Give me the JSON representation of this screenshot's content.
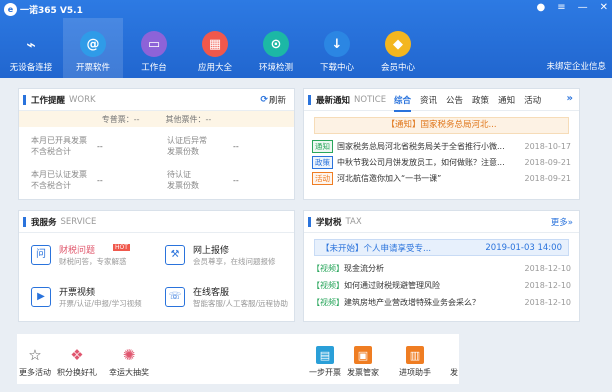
{
  "app": {
    "title": "一诺365 V5.1",
    "logo_glyph": "e",
    "unbound_label": "未绑定企业信息"
  },
  "window_controls": {
    "skin": "●",
    "menu": "≡",
    "minimize": "—",
    "close": "✕"
  },
  "nav": [
    {
      "label": "无设备连接",
      "icon": "usb-icon",
      "glyph": "⌁",
      "color": "#2166cf"
    },
    {
      "label": "开票软件",
      "icon": "paper-icon",
      "glyph": "@",
      "color": "#2f9be8"
    },
    {
      "label": "工作台",
      "icon": "monitor-icon",
      "glyph": "▭",
      "color": "#8d63d8"
    },
    {
      "label": "应用大全",
      "icon": "apps-icon",
      "glyph": "▦",
      "color": "#f0584c"
    },
    {
      "label": "环境检测",
      "icon": "check-icon",
      "glyph": "⊙",
      "color": "#1cb8a5"
    },
    {
      "label": "下载中心",
      "icon": "download-icon",
      "glyph": "↓",
      "color": "#2b86e3"
    },
    {
      "label": "会员中心",
      "icon": "diamond-icon",
      "glyph": "◆",
      "color": "#f3b61f"
    }
  ],
  "work": {
    "title": "工作提醒",
    "en": "WORK",
    "refresh": "刷新",
    "summary": {
      "zhuanpiao": "专普票：--",
      "qita": "其他票件：--"
    },
    "items": [
      {
        "label1": "本月已开具发票",
        "label2": "不含税合计",
        "value": "--"
      },
      {
        "label1": "认证后异常",
        "label2": "发票份数",
        "value": "--"
      },
      {
        "label1": "本月已认证发票",
        "label2": "不含税合计",
        "value": "--"
      },
      {
        "label1": "待认证",
        "label2": "发票份数",
        "value": "--"
      }
    ]
  },
  "notice": {
    "title": "最新通知",
    "en": "NOTICE",
    "tabs": [
      "综合",
      "资讯",
      "公告",
      "政策",
      "通知",
      "活动"
    ],
    "banner": "【通知】国家税务总局河北...",
    "items": [
      {
        "tag": "通知",
        "tag_color": "#2aa65c",
        "text": "国家税务总局河北省税务局关于全省推行小微...",
        "date": "2018-10-17"
      },
      {
        "tag": "政策",
        "tag_color": "#2a73dc",
        "text": "中秋节我公司月饼发放员工，如何做账？注意...",
        "date": "2018-09-21"
      },
      {
        "tag": "活动",
        "tag_color": "#ef7d22",
        "text": "河北航信邀你加入“一书一课”",
        "date": "2018-09-21"
      }
    ]
  },
  "service": {
    "title": "我服务",
    "en": "SERVICE",
    "items": [
      {
        "name": "财税问题",
        "badge": "HOT",
        "desc": "财税问答，专家解惑",
        "icon": "question-icon"
      },
      {
        "name": "网上报修",
        "desc": "会员尊享，在线问题报修",
        "icon": "wrench-icon"
      },
      {
        "name": "开票视频",
        "desc": "开票/认证/申报/学习视频",
        "icon": "video-icon"
      },
      {
        "name": "在线客服",
        "desc": "智能客服/人工客服/远程协助",
        "icon": "headset-icon"
      }
    ]
  },
  "tax": {
    "title": "学财税",
    "en": "TAX",
    "more": "更多»",
    "banner": {
      "tag": "【未开始】",
      "text": "个人申请享受专...",
      "datetime": "2019-01-03 14:00"
    },
    "items": [
      {
        "tag": "【视频】",
        "text": "现金流分析",
        "date": "2018-12-10"
      },
      {
        "tag": "【视频】",
        "text": "如何通过财税规避管理风险",
        "date": "2018-12-10"
      },
      {
        "tag": "【视频】",
        "text": "建筑房地产业营改增特殊业务会采么？",
        "date": "2018-12-10"
      }
    ]
  },
  "bottom": [
    {
      "label": "更多活动",
      "icon": "star-icon",
      "glyph": "☆",
      "color": "#555"
    },
    {
      "label": "积分换好礼",
      "icon": "gift-icon",
      "glyph": "❖",
      "color": "#e0566f"
    },
    {
      "label": "幸运大抽奖",
      "icon": "wheel-icon",
      "glyph": "✺",
      "color": "#e0566f"
    },
    {
      "label": "一步开票",
      "icon": "invoice-icon",
      "glyph": "▤",
      "color": "#2a9fd8"
    },
    {
      "label": "发票管家",
      "icon": "briefcase-icon",
      "glyph": "▣",
      "color": "#ef7d22"
    },
    {
      "label": "进项助手",
      "icon": "clipboard-icon",
      "glyph": "▥",
      "color": "#ef7d22"
    },
    {
      "label": "发",
      "icon": "app-icon",
      "glyph": "",
      "color": "#e9eef4"
    }
  ]
}
